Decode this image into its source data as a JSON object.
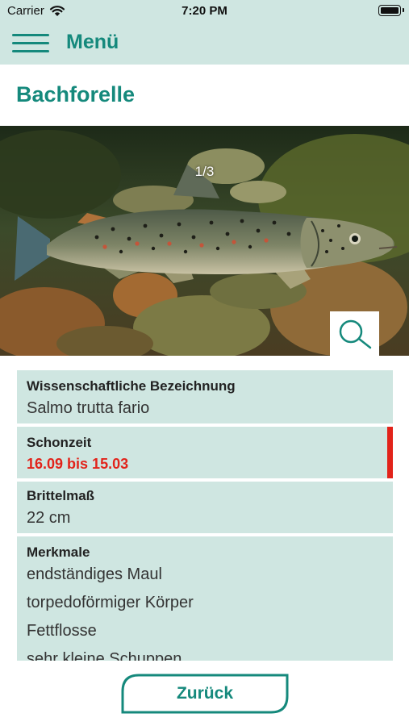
{
  "status_bar": {
    "carrier": "Carrier",
    "time": "7:20 PM",
    "wifi_icon": "wifi-icon",
    "battery_icon": "battery-icon"
  },
  "nav": {
    "menu_icon": "hamburger-menu-icon",
    "menu_label": "Menü"
  },
  "page": {
    "title": "Bachforelle"
  },
  "gallery": {
    "page_indicator": "1/3",
    "zoom_icon": "magnifier-icon"
  },
  "details": {
    "scientific": {
      "label": "Wissenschaftliche Bezeichnung",
      "value": "Salmo trutta fario"
    },
    "closed_season": {
      "label": "Schonzeit",
      "value": "16.09 bis 15.03"
    },
    "minimum_size": {
      "label": "Brittelmaß",
      "value": "22 cm"
    },
    "features": {
      "label": "Merkmale",
      "items": [
        "endständiges Maul",
        "torpedoförmiger Körper",
        "Fettflosse",
        "sehr kleine Schuppen"
      ]
    }
  },
  "footer": {
    "back_label": "Zurück"
  },
  "colors": {
    "accent": "#15897c",
    "panel": "#cfe6e1",
    "alert": "#e2231a"
  }
}
